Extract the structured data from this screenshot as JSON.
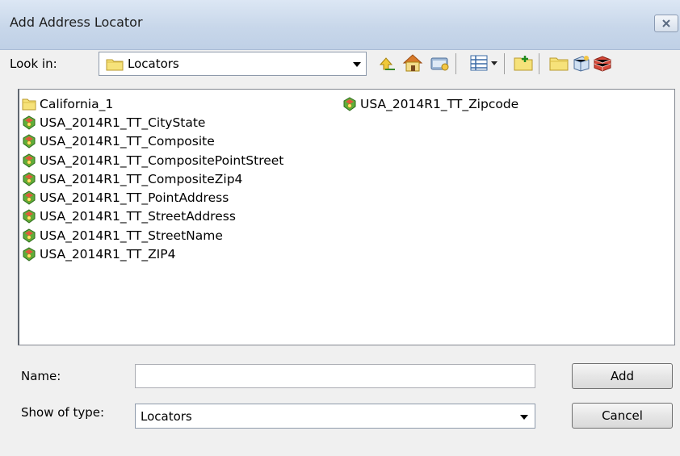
{
  "window": {
    "title": "Add Address Locator",
    "close_icon": "close-icon"
  },
  "lookin": {
    "label": "Look in:",
    "value": "Locators"
  },
  "toolbar": {
    "icons": [
      "up-one-level-icon",
      "home-icon",
      "connect-folder-icon",
      "view-list-icon",
      "view-dropdown-icon",
      "new-folder-icon",
      "folder-icon",
      "new-item-icon",
      "geodatabase-icon"
    ]
  },
  "files": {
    "column1": [
      {
        "name": "California_1",
        "icon": "folder-icon"
      },
      {
        "name": "USA_2014R1_TT_CityState",
        "icon": "locator-icon"
      },
      {
        "name": "USA_2014R1_TT_Composite",
        "icon": "locator-icon"
      },
      {
        "name": "USA_2014R1_TT_CompositePointStreet",
        "icon": "locator-icon"
      },
      {
        "name": "USA_2014R1_TT_CompositeZip4",
        "icon": "locator-icon"
      },
      {
        "name": "USA_2014R1_TT_PointAddress",
        "icon": "locator-icon"
      },
      {
        "name": "USA_2014R1_TT_StreetAddress",
        "icon": "locator-icon"
      },
      {
        "name": "USA_2014R1_TT_StreetName",
        "icon": "locator-icon"
      },
      {
        "name": "USA_2014R1_TT_ZIP4",
        "icon": "locator-icon"
      }
    ],
    "column2": [
      {
        "name": "USA_2014R1_TT_Zipcode",
        "icon": "locator-icon"
      }
    ]
  },
  "form": {
    "name_label": "Name:",
    "name_value": "",
    "type_label": "Show of type:",
    "type_value": "Locators"
  },
  "buttons": {
    "add": "Add",
    "cancel": "Cancel"
  }
}
